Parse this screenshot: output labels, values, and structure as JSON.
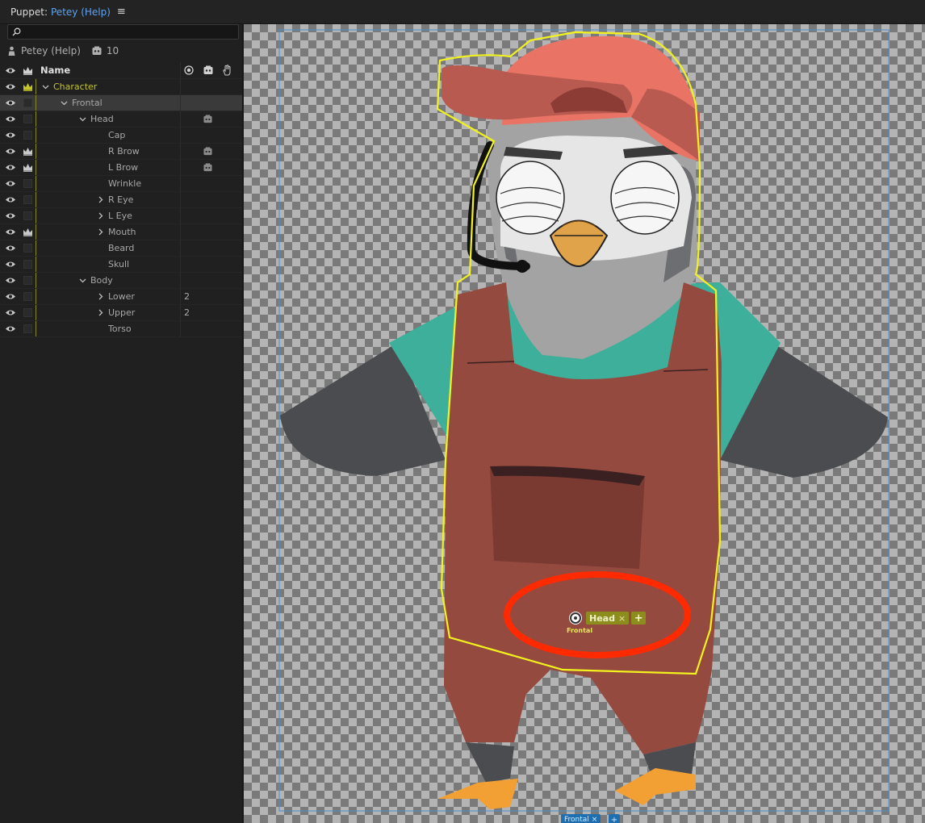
{
  "titlebar": {
    "label": "Puppet:",
    "puppet_name": "Petey (Help)",
    "menu_icon": "hamburger-icon"
  },
  "panel": {
    "search_placeholder": "",
    "puppet_name": "Petey (Help)",
    "handle_count": "10",
    "columns": {
      "name": "Name"
    },
    "rows": [
      {
        "label": "Character",
        "indent": 0,
        "chev": "down",
        "crown": true,
        "controlled": true
      },
      {
        "label": "Frontal",
        "indent": 1,
        "chev": "down",
        "crown": false,
        "selected": true
      },
      {
        "label": "Head",
        "indent": 2,
        "chev": "down",
        "crown": false,
        "tag": true
      },
      {
        "label": "Cap",
        "indent": 3,
        "chev": "",
        "crown": false
      },
      {
        "label": "R Brow",
        "indent": 3,
        "chev": "",
        "crown": true,
        "tag": true
      },
      {
        "label": "L Brow",
        "indent": 3,
        "chev": "",
        "crown": true,
        "tag": true
      },
      {
        "label": "Wrinkle",
        "indent": 3,
        "chev": "",
        "crown": false
      },
      {
        "label": "R Eye",
        "indent": 3,
        "chev": "right",
        "crown": false
      },
      {
        "label": "L Eye",
        "indent": 3,
        "chev": "right",
        "crown": false
      },
      {
        "label": "Mouth",
        "indent": 3,
        "chev": "right",
        "crown": true
      },
      {
        "label": "Beard",
        "indent": 3,
        "chev": "",
        "crown": false
      },
      {
        "label": "Skull",
        "indent": 3,
        "chev": "",
        "crown": false
      },
      {
        "label": "Body",
        "indent": 2,
        "chev": "down",
        "crown": false
      },
      {
        "label": "Lower",
        "indent": 3,
        "chev": "right",
        "crown": false,
        "count": "2"
      },
      {
        "label": "Upper",
        "indent": 3,
        "chev": "right",
        "crown": false,
        "count": "2"
      },
      {
        "label": "Torso",
        "indent": 3,
        "chev": "",
        "crown": false
      }
    ]
  },
  "canvas": {
    "handle_tag": "Head",
    "handle_tag_remove": "×",
    "add_tag": "+",
    "origin_label": "Frontal",
    "bottom_tag": "Frontal",
    "bottom_tag_remove": "×",
    "bottom_add": "+"
  },
  "colors": {
    "accent_blue": "#5ea4f0",
    "controlled_yellow": "#c5c52a",
    "tag_olive": "#8d8d1e",
    "outline_yellow": "#f2f21e",
    "annotation_red": "#ff2a00"
  }
}
